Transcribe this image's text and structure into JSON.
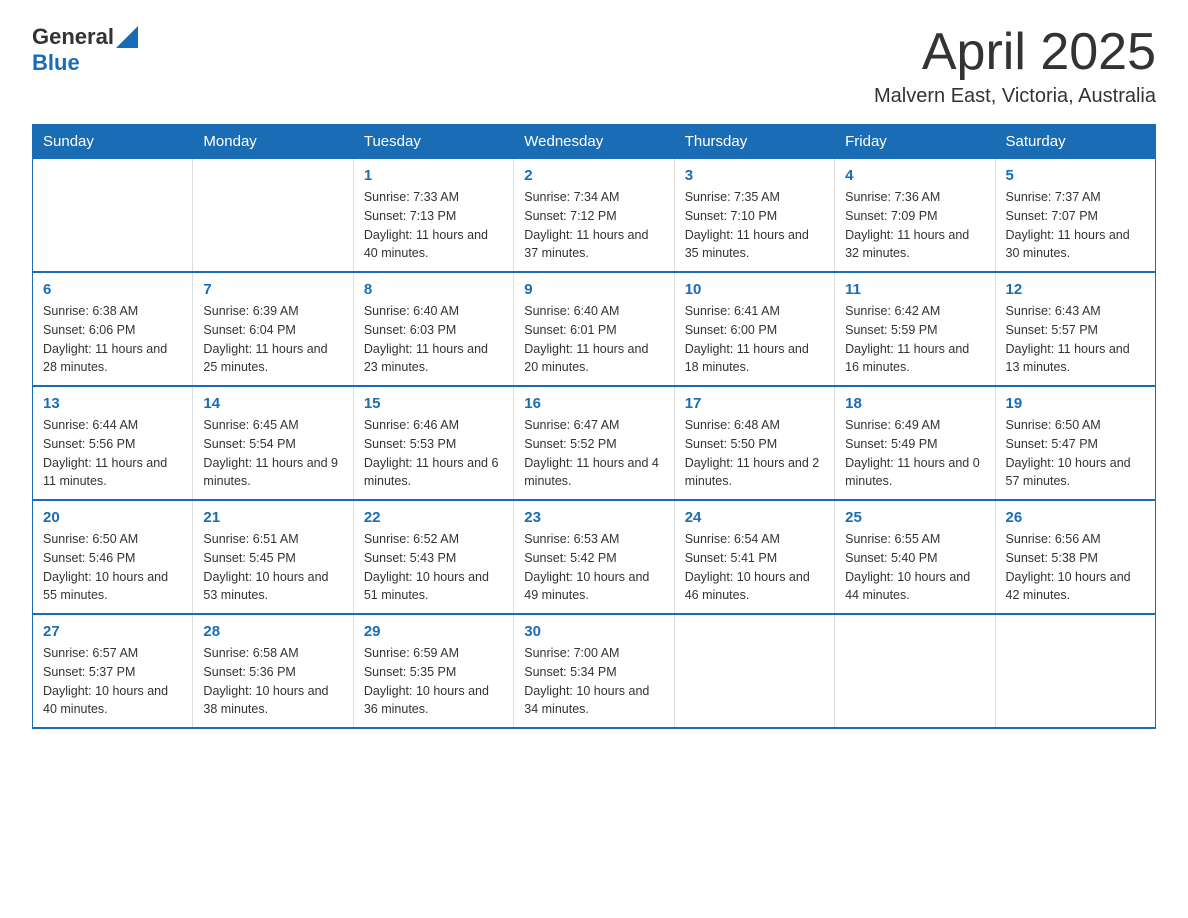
{
  "header": {
    "logo_general": "General",
    "logo_blue": "Blue",
    "month": "April 2025",
    "location": "Malvern East, Victoria, Australia"
  },
  "weekdays": [
    "Sunday",
    "Monday",
    "Tuesday",
    "Wednesday",
    "Thursday",
    "Friday",
    "Saturday"
  ],
  "weeks": [
    [
      {
        "day": "",
        "sunrise": "",
        "sunset": "",
        "daylight": ""
      },
      {
        "day": "",
        "sunrise": "",
        "sunset": "",
        "daylight": ""
      },
      {
        "day": "1",
        "sunrise": "Sunrise: 7:33 AM",
        "sunset": "Sunset: 7:13 PM",
        "daylight": "Daylight: 11 hours and 40 minutes."
      },
      {
        "day": "2",
        "sunrise": "Sunrise: 7:34 AM",
        "sunset": "Sunset: 7:12 PM",
        "daylight": "Daylight: 11 hours and 37 minutes."
      },
      {
        "day": "3",
        "sunrise": "Sunrise: 7:35 AM",
        "sunset": "Sunset: 7:10 PM",
        "daylight": "Daylight: 11 hours and 35 minutes."
      },
      {
        "day": "4",
        "sunrise": "Sunrise: 7:36 AM",
        "sunset": "Sunset: 7:09 PM",
        "daylight": "Daylight: 11 hours and 32 minutes."
      },
      {
        "day": "5",
        "sunrise": "Sunrise: 7:37 AM",
        "sunset": "Sunset: 7:07 PM",
        "daylight": "Daylight: 11 hours and 30 minutes."
      }
    ],
    [
      {
        "day": "6",
        "sunrise": "Sunrise: 6:38 AM",
        "sunset": "Sunset: 6:06 PM",
        "daylight": "Daylight: 11 hours and 28 minutes."
      },
      {
        "day": "7",
        "sunrise": "Sunrise: 6:39 AM",
        "sunset": "Sunset: 6:04 PM",
        "daylight": "Daylight: 11 hours and 25 minutes."
      },
      {
        "day": "8",
        "sunrise": "Sunrise: 6:40 AM",
        "sunset": "Sunset: 6:03 PM",
        "daylight": "Daylight: 11 hours and 23 minutes."
      },
      {
        "day": "9",
        "sunrise": "Sunrise: 6:40 AM",
        "sunset": "Sunset: 6:01 PM",
        "daylight": "Daylight: 11 hours and 20 minutes."
      },
      {
        "day": "10",
        "sunrise": "Sunrise: 6:41 AM",
        "sunset": "Sunset: 6:00 PM",
        "daylight": "Daylight: 11 hours and 18 minutes."
      },
      {
        "day": "11",
        "sunrise": "Sunrise: 6:42 AM",
        "sunset": "Sunset: 5:59 PM",
        "daylight": "Daylight: 11 hours and 16 minutes."
      },
      {
        "day": "12",
        "sunrise": "Sunrise: 6:43 AM",
        "sunset": "Sunset: 5:57 PM",
        "daylight": "Daylight: 11 hours and 13 minutes."
      }
    ],
    [
      {
        "day": "13",
        "sunrise": "Sunrise: 6:44 AM",
        "sunset": "Sunset: 5:56 PM",
        "daylight": "Daylight: 11 hours and 11 minutes."
      },
      {
        "day": "14",
        "sunrise": "Sunrise: 6:45 AM",
        "sunset": "Sunset: 5:54 PM",
        "daylight": "Daylight: 11 hours and 9 minutes."
      },
      {
        "day": "15",
        "sunrise": "Sunrise: 6:46 AM",
        "sunset": "Sunset: 5:53 PM",
        "daylight": "Daylight: 11 hours and 6 minutes."
      },
      {
        "day": "16",
        "sunrise": "Sunrise: 6:47 AM",
        "sunset": "Sunset: 5:52 PM",
        "daylight": "Daylight: 11 hours and 4 minutes."
      },
      {
        "day": "17",
        "sunrise": "Sunrise: 6:48 AM",
        "sunset": "Sunset: 5:50 PM",
        "daylight": "Daylight: 11 hours and 2 minutes."
      },
      {
        "day": "18",
        "sunrise": "Sunrise: 6:49 AM",
        "sunset": "Sunset: 5:49 PM",
        "daylight": "Daylight: 11 hours and 0 minutes."
      },
      {
        "day": "19",
        "sunrise": "Sunrise: 6:50 AM",
        "sunset": "Sunset: 5:47 PM",
        "daylight": "Daylight: 10 hours and 57 minutes."
      }
    ],
    [
      {
        "day": "20",
        "sunrise": "Sunrise: 6:50 AM",
        "sunset": "Sunset: 5:46 PM",
        "daylight": "Daylight: 10 hours and 55 minutes."
      },
      {
        "day": "21",
        "sunrise": "Sunrise: 6:51 AM",
        "sunset": "Sunset: 5:45 PM",
        "daylight": "Daylight: 10 hours and 53 minutes."
      },
      {
        "day": "22",
        "sunrise": "Sunrise: 6:52 AM",
        "sunset": "Sunset: 5:43 PM",
        "daylight": "Daylight: 10 hours and 51 minutes."
      },
      {
        "day": "23",
        "sunrise": "Sunrise: 6:53 AM",
        "sunset": "Sunset: 5:42 PM",
        "daylight": "Daylight: 10 hours and 49 minutes."
      },
      {
        "day": "24",
        "sunrise": "Sunrise: 6:54 AM",
        "sunset": "Sunset: 5:41 PM",
        "daylight": "Daylight: 10 hours and 46 minutes."
      },
      {
        "day": "25",
        "sunrise": "Sunrise: 6:55 AM",
        "sunset": "Sunset: 5:40 PM",
        "daylight": "Daylight: 10 hours and 44 minutes."
      },
      {
        "day": "26",
        "sunrise": "Sunrise: 6:56 AM",
        "sunset": "Sunset: 5:38 PM",
        "daylight": "Daylight: 10 hours and 42 minutes."
      }
    ],
    [
      {
        "day": "27",
        "sunrise": "Sunrise: 6:57 AM",
        "sunset": "Sunset: 5:37 PM",
        "daylight": "Daylight: 10 hours and 40 minutes."
      },
      {
        "day": "28",
        "sunrise": "Sunrise: 6:58 AM",
        "sunset": "Sunset: 5:36 PM",
        "daylight": "Daylight: 10 hours and 38 minutes."
      },
      {
        "day": "29",
        "sunrise": "Sunrise: 6:59 AM",
        "sunset": "Sunset: 5:35 PM",
        "daylight": "Daylight: 10 hours and 36 minutes."
      },
      {
        "day": "30",
        "sunrise": "Sunrise: 7:00 AM",
        "sunset": "Sunset: 5:34 PM",
        "daylight": "Daylight: 10 hours and 34 minutes."
      },
      {
        "day": "",
        "sunrise": "",
        "sunset": "",
        "daylight": ""
      },
      {
        "day": "",
        "sunrise": "",
        "sunset": "",
        "daylight": ""
      },
      {
        "day": "",
        "sunrise": "",
        "sunset": "",
        "daylight": ""
      }
    ]
  ]
}
